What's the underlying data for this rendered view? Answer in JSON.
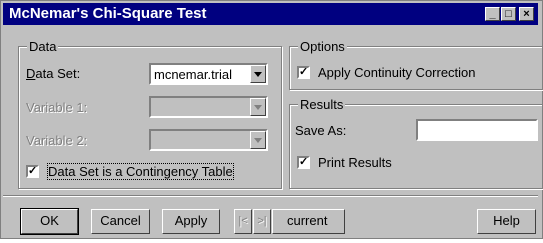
{
  "window": {
    "title": "McNemar's Chi-Square Test"
  },
  "data_group": {
    "legend": "Data",
    "data_set_label": "Data Set:",
    "data_set_value": "mcnemar.trial",
    "variable1_label": "Variable 1:",
    "variable2_label": "Variable 2:",
    "contingency_label": "Data Set is a Contingency Table",
    "contingency_checked": true
  },
  "options_group": {
    "legend": "Options",
    "continuity_label": "Apply Continuity Correction",
    "continuity_checked": true
  },
  "results_group": {
    "legend": "Results",
    "save_as_label": "Save As:",
    "save_as_value": "",
    "print_label": "Print Results",
    "print_checked": true
  },
  "buttons": {
    "ok": "OK",
    "cancel": "Cancel",
    "apply": "Apply",
    "prev": "|<",
    "next": ">|",
    "current": "current",
    "help": "Help"
  },
  "title_buttons": {
    "minimize": "_",
    "maximize": "□",
    "close": "×"
  }
}
